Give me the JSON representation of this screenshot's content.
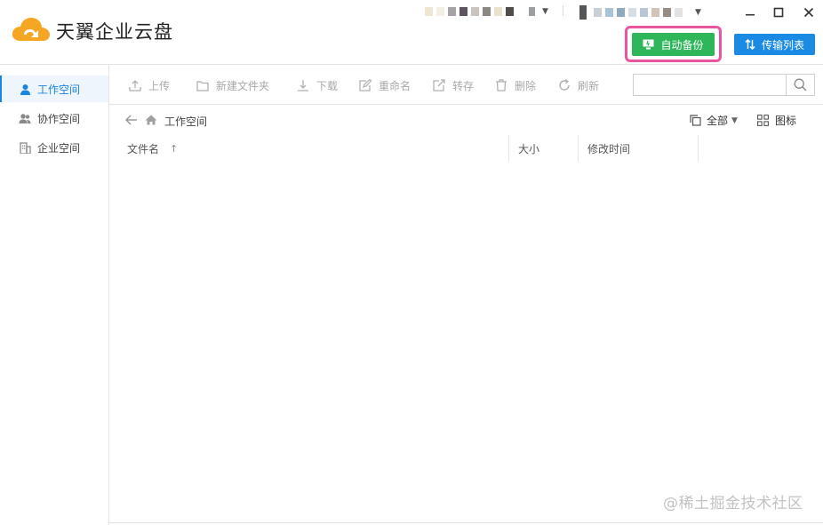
{
  "app": {
    "title": "天翼企业云盘",
    "logo_colors": {
      "outer": "#f5a623",
      "inner": "#ffffff"
    }
  },
  "account": {
    "dropdown_icon": "caret-down-icon"
  },
  "window_controls": {
    "icons": [
      "caret-down-icon",
      "minimize-icon",
      "maximize-icon",
      "close-icon"
    ]
  },
  "header_buttons": {
    "backup_label": "自动备份",
    "backup_color": "#2fb55a",
    "highlight_color": "#e9569f",
    "transfer_label": "传输列表",
    "transfer_color": "#1a8ae5"
  },
  "sidebar": {
    "items": [
      {
        "label": "工作空间",
        "icon": "user-icon",
        "active": true
      },
      {
        "label": "协作空间",
        "icon": "users-icon",
        "active": false
      },
      {
        "label": "企业空间",
        "icon": "building-icon",
        "active": false
      }
    ]
  },
  "toolbar": {
    "upload": "上传",
    "new_folder": "新建文件夹",
    "download": "下载",
    "rename": "重命名",
    "save_to": "转存",
    "delete": "删除",
    "refresh": "刷新",
    "search_placeholder": ""
  },
  "breadcrumb": {
    "current": "工作空间"
  },
  "filter": {
    "label": "全部"
  },
  "view": {
    "label": "图标"
  },
  "table": {
    "columns": [
      "文件名",
      "大小",
      "修改时间"
    ],
    "sort_indicator": "↑"
  },
  "watermark": "@稀土掘金技术社区"
}
